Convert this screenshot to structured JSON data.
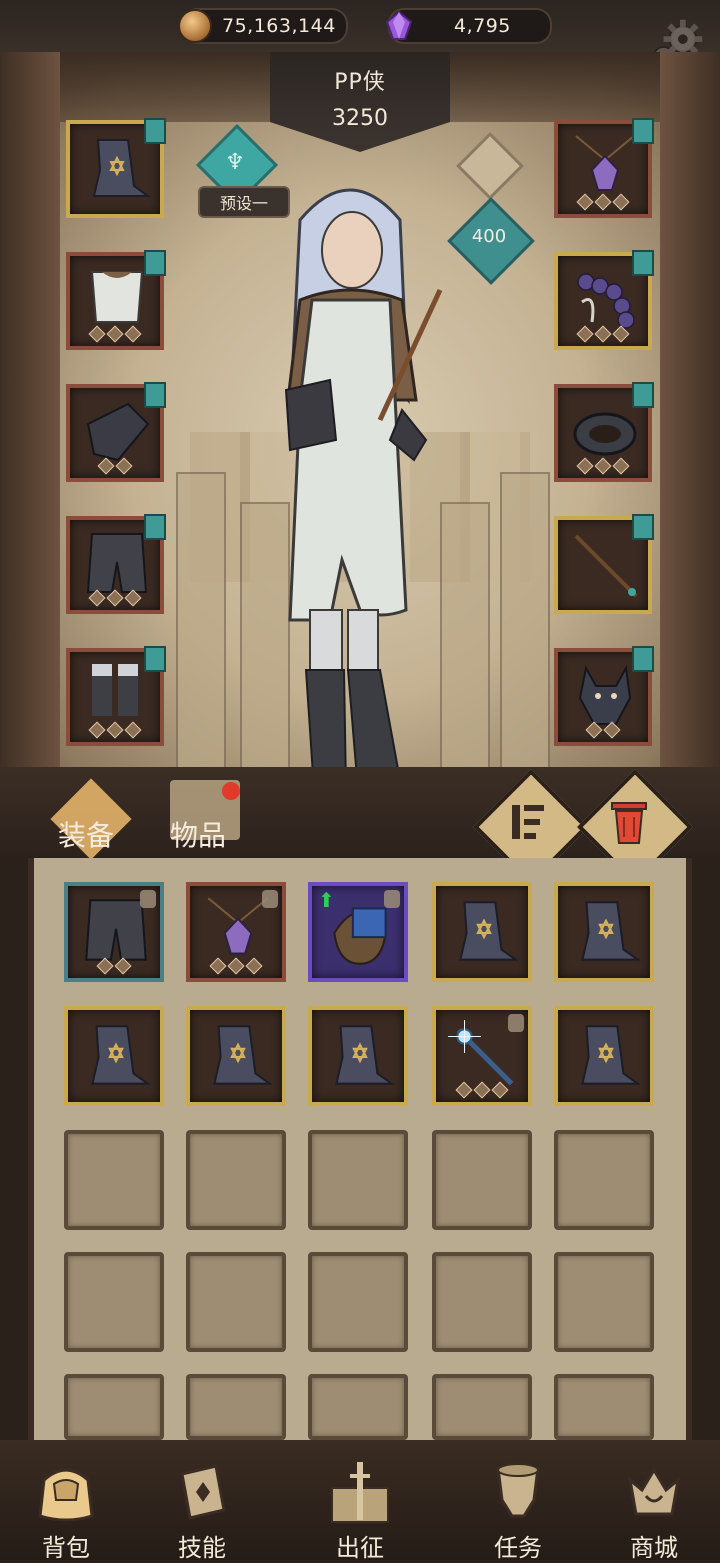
{
  "resources": {
    "coins": "75,163,144",
    "gems": "4,795"
  },
  "hero": {
    "name": "PP侠",
    "power": "3250",
    "preset": "预设一",
    "level": "400"
  },
  "tabs": {
    "equip": "装备",
    "items": "物品"
  },
  "nav": [
    {
      "label": "背包"
    },
    {
      "label": "技能"
    },
    {
      "label": "出征"
    },
    {
      "label": "任务"
    },
    {
      "label": "商城"
    }
  ],
  "icons": {
    "settings": "gear-icon",
    "coin": "coin-icon",
    "gem": "gem-icon"
  }
}
